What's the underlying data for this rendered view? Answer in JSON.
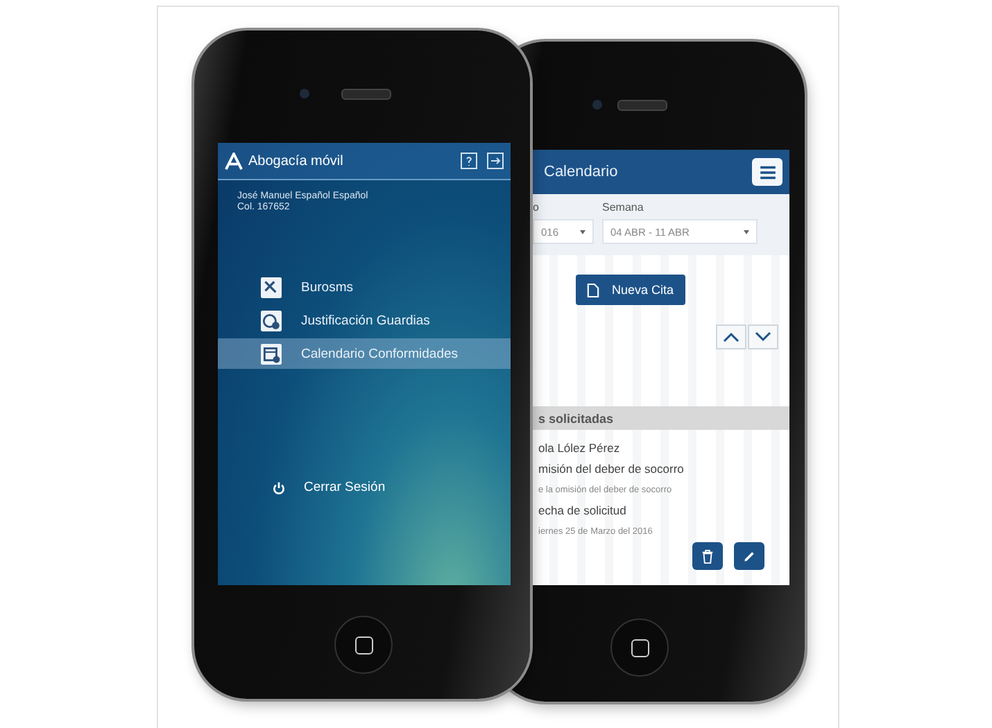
{
  "phones": [
    {
      "kind": "menu",
      "app_title": "Abogacía móvil",
      "user_name": "José Manuel Español Español",
      "user_id": "Col. 167652",
      "menu_items": [
        {
          "label": "Burosms",
          "selected": false
        },
        {
          "label": "Justificación Guardias",
          "selected": false
        },
        {
          "label": "Calendario Conformidades",
          "selected": true
        }
      ],
      "logout": "Cerrar Sesión"
    },
    {
      "kind": "calendar",
      "title": "Calendario",
      "year_label": "o",
      "year_value": "016",
      "week_label": "Semana",
      "week_value": "04 ABR - 11 ABR",
      "new_button": "Nueva Cita",
      "section_title": "s solicitadas",
      "lines": [
        {
          "text": "ola Lólez Pérez",
          "kind": "main"
        },
        {
          "text": "misión del deber de socorro",
          "kind": "main"
        },
        {
          "text": "e la omisión del deber de socorro",
          "kind": "sub"
        },
        {
          "text": "echa de solicitud",
          "kind": "main"
        },
        {
          "text": "iernes 25 de Marzo del 2016",
          "kind": "sub"
        }
      ]
    }
  ]
}
